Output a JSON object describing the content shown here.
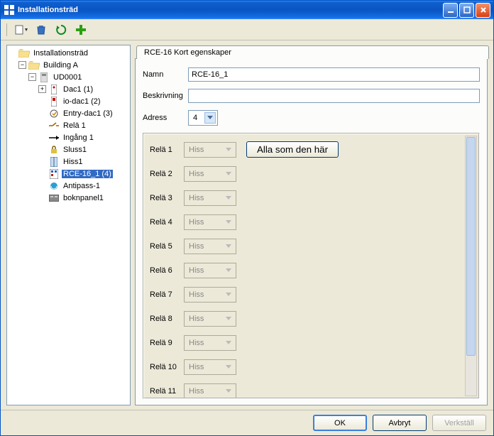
{
  "window": {
    "title": "Installationsträd"
  },
  "toolbar": {
    "new_dropdown": "new",
    "delete": "delete",
    "refresh": "refresh",
    "add": "add"
  },
  "tree": {
    "root": {
      "label": "Installationsträd",
      "children": [
        {
          "label": "Building A",
          "children": [
            {
              "label": "UD0001",
              "children": [
                {
                  "label": "Dac1 (1)",
                  "expandable": true
                },
                {
                  "label": "io-dac1 (2)"
                },
                {
                  "label": "Entry-dac1 (3)"
                },
                {
                  "label": "Relä 1"
                },
                {
                  "label": "Ingång 1"
                },
                {
                  "label": "Sluss1"
                },
                {
                  "label": "Hiss1"
                },
                {
                  "label": "RCE-16_1 (4)",
                  "selected": true
                },
                {
                  "label": "Antipass-1"
                },
                {
                  "label": "boknpanel1"
                }
              ]
            }
          ]
        }
      ]
    }
  },
  "tab": {
    "title": "RCE-16 Kort egenskaper"
  },
  "form": {
    "name_label": "Namn",
    "name_value": "RCE-16_1",
    "desc_label": "Beskrivning",
    "desc_value": "",
    "addr_label": "Adress",
    "addr_value": "4"
  },
  "relays": {
    "all_like_this": "Alla som den här",
    "rows": [
      {
        "label": "Relä 1",
        "value": "Hiss"
      },
      {
        "label": "Relä 2",
        "value": "Hiss"
      },
      {
        "label": "Relä 3",
        "value": "Hiss"
      },
      {
        "label": "Relä 4",
        "value": "Hiss"
      },
      {
        "label": "Relä 5",
        "value": "Hiss"
      },
      {
        "label": "Relä 6",
        "value": "Hiss"
      },
      {
        "label": "Relä 7",
        "value": "Hiss"
      },
      {
        "label": "Relä 8",
        "value": "Hiss"
      },
      {
        "label": "Relä 9",
        "value": "Hiss"
      },
      {
        "label": "Relä 10",
        "value": "Hiss"
      },
      {
        "label": "Relä 11",
        "value": "Hiss"
      }
    ]
  },
  "buttons": {
    "ok": "OK",
    "cancel": "Avbryt",
    "apply": "Verkställ"
  }
}
